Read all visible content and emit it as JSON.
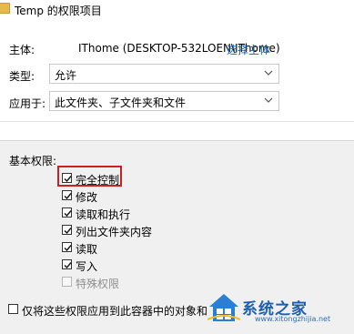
{
  "window": {
    "title": "Temp 的权限项目"
  },
  "principal": {
    "label": "主体:",
    "value": "IThome (DESKTOP-532LOEN\\IThome)",
    "select_link": "选择主体"
  },
  "type": {
    "label": "类型:",
    "value": "允许"
  },
  "applies_to": {
    "label": "应用于:",
    "value": "此文件夹、子文件夹和文件"
  },
  "basic_permissions": {
    "heading": "基本权限:",
    "items": [
      {
        "label": "完全控制",
        "checked": true,
        "enabled": true
      },
      {
        "label": "修改",
        "checked": true,
        "enabled": true
      },
      {
        "label": "读取和执行",
        "checked": true,
        "enabled": true
      },
      {
        "label": "列出文件夹内容",
        "checked": true,
        "enabled": true
      },
      {
        "label": "读取",
        "checked": true,
        "enabled": true
      },
      {
        "label": "写入",
        "checked": true,
        "enabled": true
      },
      {
        "label": "特殊权限",
        "checked": false,
        "enabled": false
      }
    ]
  },
  "apply_container": {
    "label": "仅将这些权限应用到此容器中的对象和",
    "checked": false
  },
  "watermark": {
    "brand": "系统之家",
    "url": "www.xitongzhijia.net"
  },
  "colors": {
    "highlight": "#cc1f1f",
    "link": "#0066cc",
    "group_bg": "#f0f0f0"
  }
}
